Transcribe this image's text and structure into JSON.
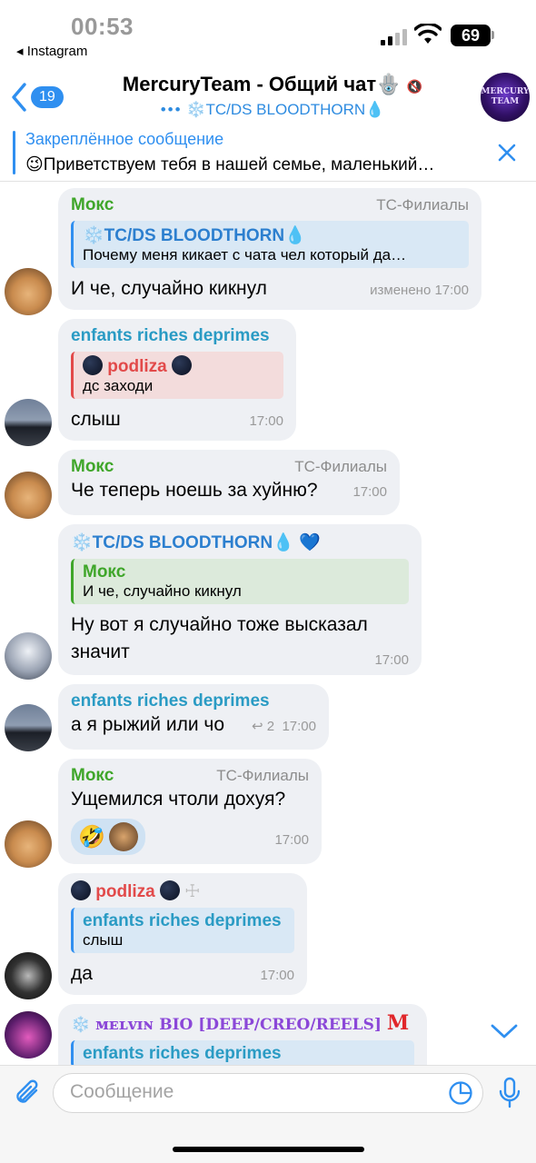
{
  "status": {
    "time": "00:53",
    "back_app": "◂ Instagram",
    "battery": "69"
  },
  "header": {
    "back_count": "19",
    "title": "MercuryTeam - Общий чат",
    "hamsa": "🪬",
    "subtitle_dots": "•••",
    "subtitle": "❄️TC/DS BLOODTHORN💧",
    "avatar_text": "MERCURY TEAM"
  },
  "pinned": {
    "title": "Закреплённое сообщение",
    "text": "😉Приветствуем тебя в нашей семье, маленький…"
  },
  "messages": [
    {
      "sender": "Мокс",
      "role": "TC-Филиалы",
      "reply_name": "❄️TC/DS BLOODTHORN💧",
      "reply_text": "Почему меня кикает с чата чел который да…",
      "text": "И че, случайно кикнул",
      "time": "изменено 17:00"
    },
    {
      "sender": "enfants riches deprimes",
      "reply_name": "podliza",
      "reply_text": "дс заходи",
      "text": "слыш",
      "time": "17:00"
    },
    {
      "sender": "Мокс",
      "role": "TC-Филиалы",
      "text": "Че теперь ноешь за хуйню?",
      "time": "17:00"
    },
    {
      "sender": "❄️TC/DS BLOODTHORN💧",
      "badge": "💙",
      "reply_name": "Мокс",
      "reply_text": "И че, случайно кикнул",
      "text": "Ну вот я случайно тоже высказал значит",
      "time": "17:00"
    },
    {
      "sender": "enfants riches deprimes",
      "text": "а я рыжий или чо",
      "reply_count": "2",
      "time": "17:00"
    },
    {
      "sender": "Мокс",
      "role": "TC-Филиалы",
      "text": "Ущемился чтоли дохуя?",
      "reaction": "🤣",
      "time": "17:00"
    },
    {
      "sender": "podliza",
      "cross": "☩",
      "reply_name": "enfants riches deprimes",
      "reply_text": "слыш",
      "text": "да",
      "time": "17:00"
    },
    {
      "sender_prefix": "❄️",
      "sender": "ᴍᴇʟᴠɪɴ BIO [DEEP/CREO/REELS]",
      "sender_suffix": "M",
      "reply_name": "enfants riches deprimes"
    }
  ],
  "input": {
    "placeholder": "Сообщение"
  },
  "colors": {
    "accent": "#2f8ff0",
    "green_name": "#3fa62a",
    "teal_name": "#2a9bc4",
    "red_name": "#e24a4a"
  }
}
